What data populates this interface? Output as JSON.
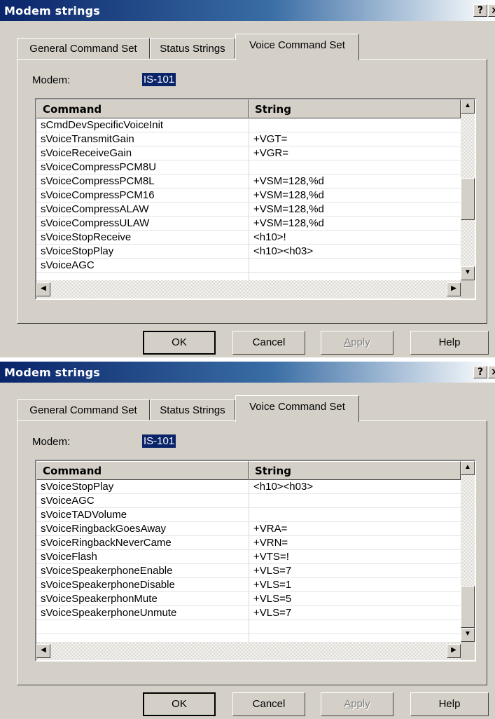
{
  "dialogs": [
    {
      "title": "Modem strings",
      "help_glyph": "?",
      "close_glyph": "×",
      "tabs": [
        "General Command Set",
        "Status Strings",
        "Voice Command Set"
      ],
      "modem_label": "Modem:",
      "modem_value": "IS-101",
      "columns": [
        "Command",
        "String"
      ],
      "rows": [
        {
          "command": "sCmdDevSpecificVoiceInit",
          "string": ""
        },
        {
          "command": "sVoiceTransmitGain",
          "string": "+VGT="
        },
        {
          "command": "sVoiceReceiveGain",
          "string": "+VGR="
        },
        {
          "command": "sVoiceCompressPCM8U",
          "string": ""
        },
        {
          "command": "sVoiceCompressPCM8L",
          "string": "+VSM=128,%d"
        },
        {
          "command": "sVoiceCompressPCM16",
          "string": "+VSM=128,%d"
        },
        {
          "command": "sVoiceCompressALAW",
          "string": "+VSM=128,%d"
        },
        {
          "command": "sVoiceCompressULAW",
          "string": "+VSM=128,%d"
        },
        {
          "command": "sVoiceStopReceive",
          "string": "<h10>!"
        },
        {
          "command": "sVoiceStopPlay",
          "string": "<h10><h03>"
        },
        {
          "command": "sVoiceAGC",
          "string": ""
        }
      ],
      "vscroll_position": 0.58,
      "buttons": {
        "ok": "OK",
        "cancel": "Cancel",
        "apply": "Apply",
        "apply_mnemonic": "A",
        "apply_rest": "pply",
        "help": "Help"
      }
    },
    {
      "title": "Modem strings",
      "help_glyph": "?",
      "close_glyph": "×",
      "tabs": [
        "General Command Set",
        "Status Strings",
        "Voice Command Set"
      ],
      "modem_label": "Modem:",
      "modem_value": "IS-101",
      "columns": [
        "Command",
        "String"
      ],
      "rows": [
        {
          "command": "sVoiceStopPlay",
          "string": "<h10><h03>"
        },
        {
          "command": "sVoiceAGC",
          "string": ""
        },
        {
          "command": "sVoiceTADVolume",
          "string": ""
        },
        {
          "command": "sVoiceRingbackGoesAway",
          "string": "+VRA="
        },
        {
          "command": "sVoiceRingbackNeverCame",
          "string": "+VRN="
        },
        {
          "command": "sVoiceFlash",
          "string": "+VTS=!"
        },
        {
          "command": "sVoiceSpeakerphoneEnable",
          "string": "+VLS=7"
        },
        {
          "command": "sVoiceSpeakerphoneDisable",
          "string": "+VLS=1"
        },
        {
          "command": "sVoiceSpeakerphonMute",
          "string": "+VLS=5"
        },
        {
          "command": "sVoiceSpeakerphoneUnmute",
          "string": "+VLS=7"
        },
        {
          "command": "",
          "string": ""
        }
      ],
      "vscroll_position": 1.0,
      "buttons": {
        "ok": "OK",
        "cancel": "Cancel",
        "apply": "Apply",
        "apply_mnemonic": "A",
        "apply_rest": "pply",
        "help": "Help"
      }
    }
  ]
}
